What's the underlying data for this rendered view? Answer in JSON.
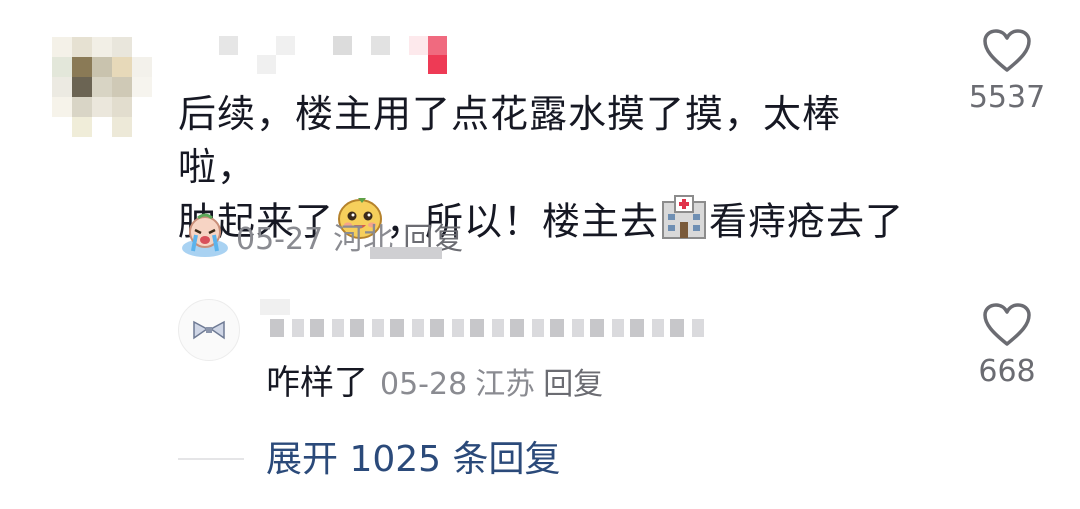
{
  "comment": {
    "text_line1": "后续，楼主用了点花露水摸了摸，太棒啦，",
    "text_line2_a": "肿起来了",
    "text_line2_b": "，所以！楼主去",
    "text_line2_c": "看痔疮去了",
    "date": "05-27",
    "location": "河北",
    "reply_label": "回复",
    "like_count": "5537"
  },
  "reply": {
    "text": "咋样了",
    "date": "05-28",
    "location": "江苏",
    "reply_label": "回复",
    "like_count": "668"
  },
  "expand": {
    "label": "展开 1025 条回复"
  },
  "colors": {
    "text": "#161823",
    "meta": "#8a8b91",
    "link": "#2b4a7a",
    "heart": "#6b6c72"
  }
}
